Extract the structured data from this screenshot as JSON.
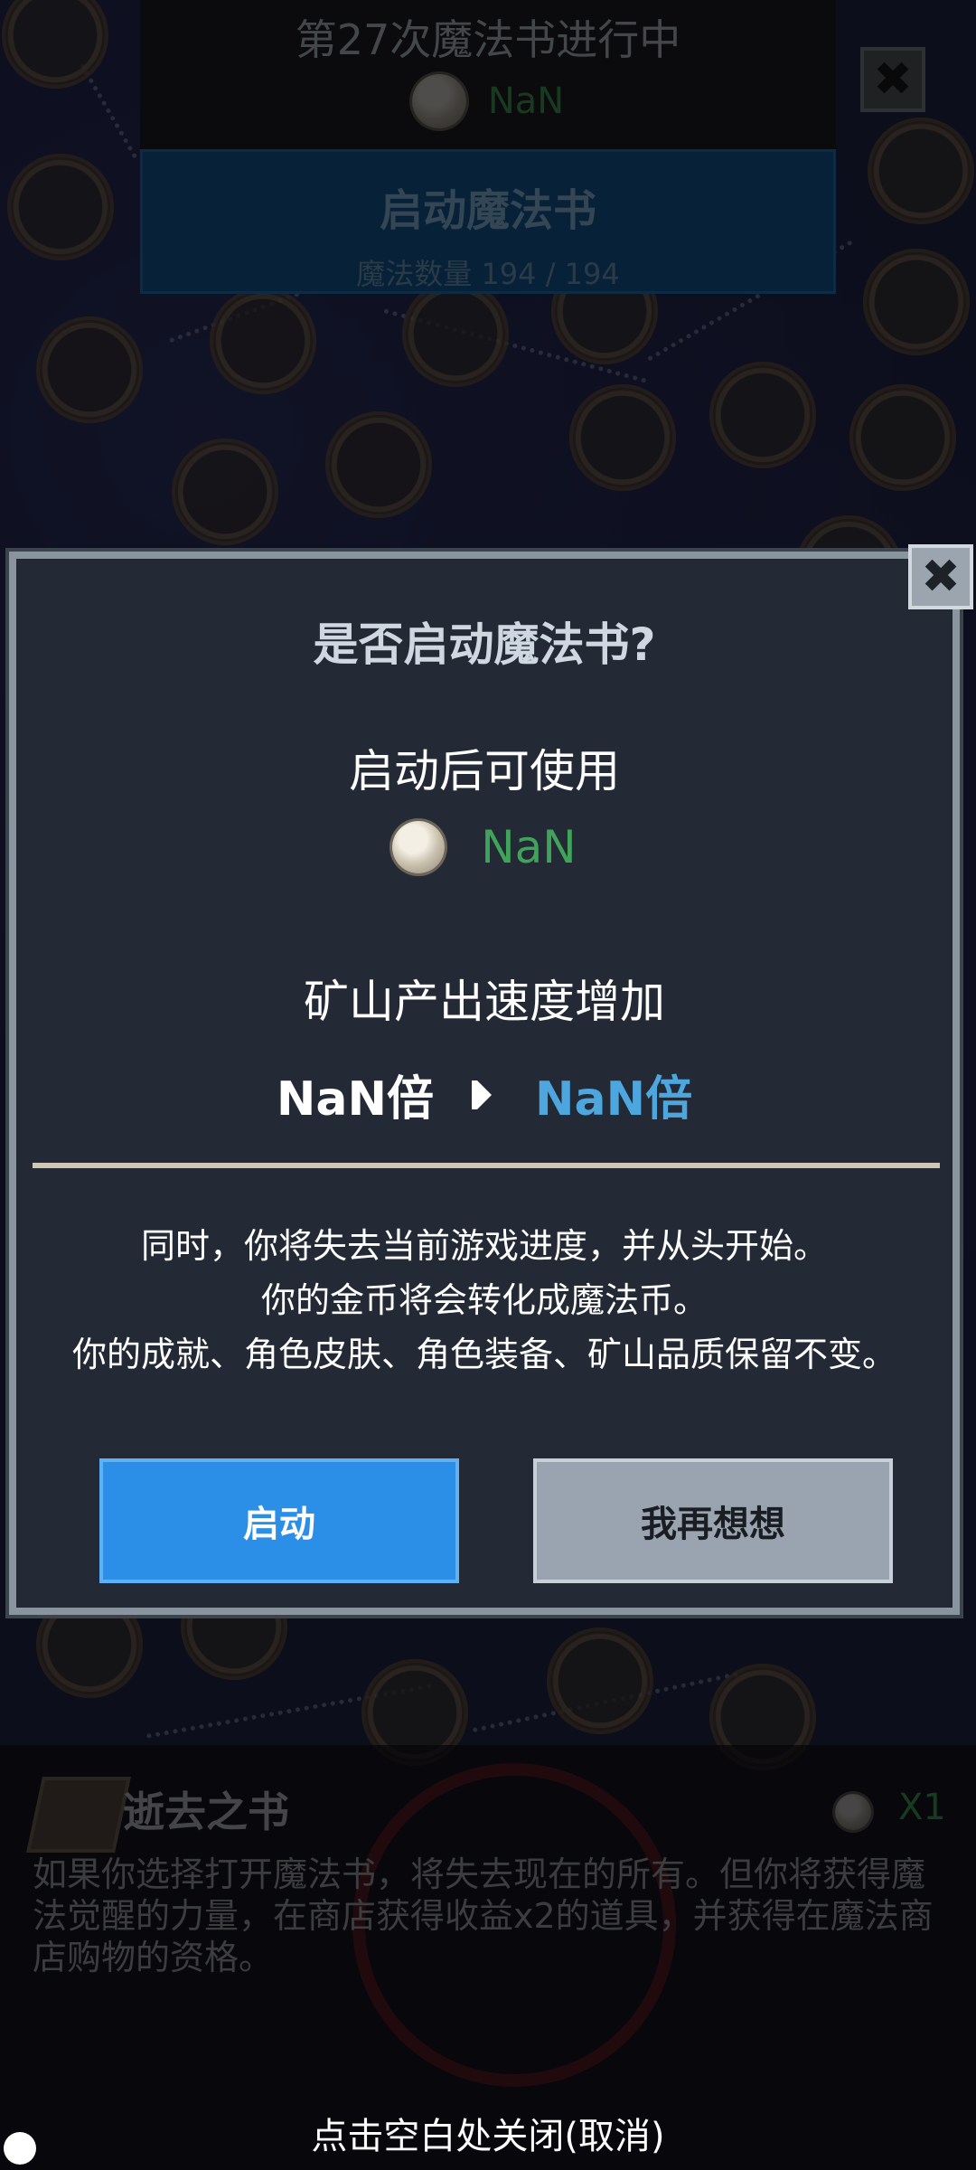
{
  "top": {
    "title": "第27次魔法书进行中",
    "coin_value": "NaN",
    "start_button": "启动魔法书",
    "magic_count": "魔法数量 194 / 194",
    "close_icon": "✖"
  },
  "modal": {
    "title": "是否启动魔法书?",
    "usable_label": "启动后可使用",
    "coin_value": "NaN",
    "speed_label": "矿山产出速度增加",
    "rate_old": "NaN倍",
    "rate_new": "NaN倍",
    "warning_lines": [
      "同时，你将失去当前游戏进度，并从头开始。",
      "你的金币将会转化成魔法币。",
      "你的成就、角色皮肤、角色装备、矿山品质保留不变。"
    ],
    "confirm_button": "启动",
    "cancel_button": "我再想想",
    "close_icon": "✖"
  },
  "bottom": {
    "title": "逝去之书",
    "count": "X1",
    "description": "如果你选择打开魔法书，将失去现在的所有。但你将获得魔法觉醒的力量，在商店获得收益x2的道具，并获得在魔法商店购物的资格。",
    "close_hint": "点击空白处关闭(取消)"
  },
  "colors": {
    "accent_blue": "#2b8fe7",
    "coin_green": "#3fa35a",
    "rate_blue": "#4ea6de",
    "panel_bg": "#232a35"
  }
}
